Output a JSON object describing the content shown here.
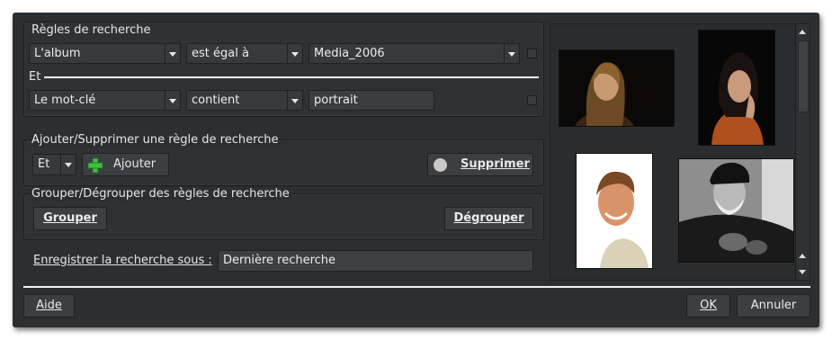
{
  "rules": {
    "title": "Règles de recherche",
    "row1": {
      "field": "L'album",
      "operator": "est égal à",
      "value": "Media_2006"
    },
    "conjunction": "Et",
    "row2": {
      "field": "Le mot-clé",
      "operator": "contient",
      "value": "portrait"
    }
  },
  "add_remove": {
    "title": "Ajouter/Supprimer une règle de recherche",
    "operator_value": "Et",
    "add_label": "Ajouter",
    "remove_label": "Supprimer"
  },
  "grouping": {
    "title": "Grouper/Dégrouper des règles de recherche",
    "group_label": "Grouper",
    "ungroup_label": "Dégrouper"
  },
  "save": {
    "label": "Enregistrer la recherche sous :",
    "value": "Dernière recherche"
  },
  "footer": {
    "help_label": "Aide",
    "ok_label": "OK",
    "cancel_label": "Annuler"
  },
  "thumbnails": [
    {
      "icon": "portrait-woman-blonde"
    },
    {
      "icon": "portrait-woman-dark-hair"
    },
    {
      "icon": "portrait-man-smiling"
    },
    {
      "icon": "portrait-old-man-cap"
    }
  ],
  "colors": {
    "background": "#2c2f31",
    "add_icon": "#3fbf3f",
    "separator": "#f2f2f2"
  }
}
